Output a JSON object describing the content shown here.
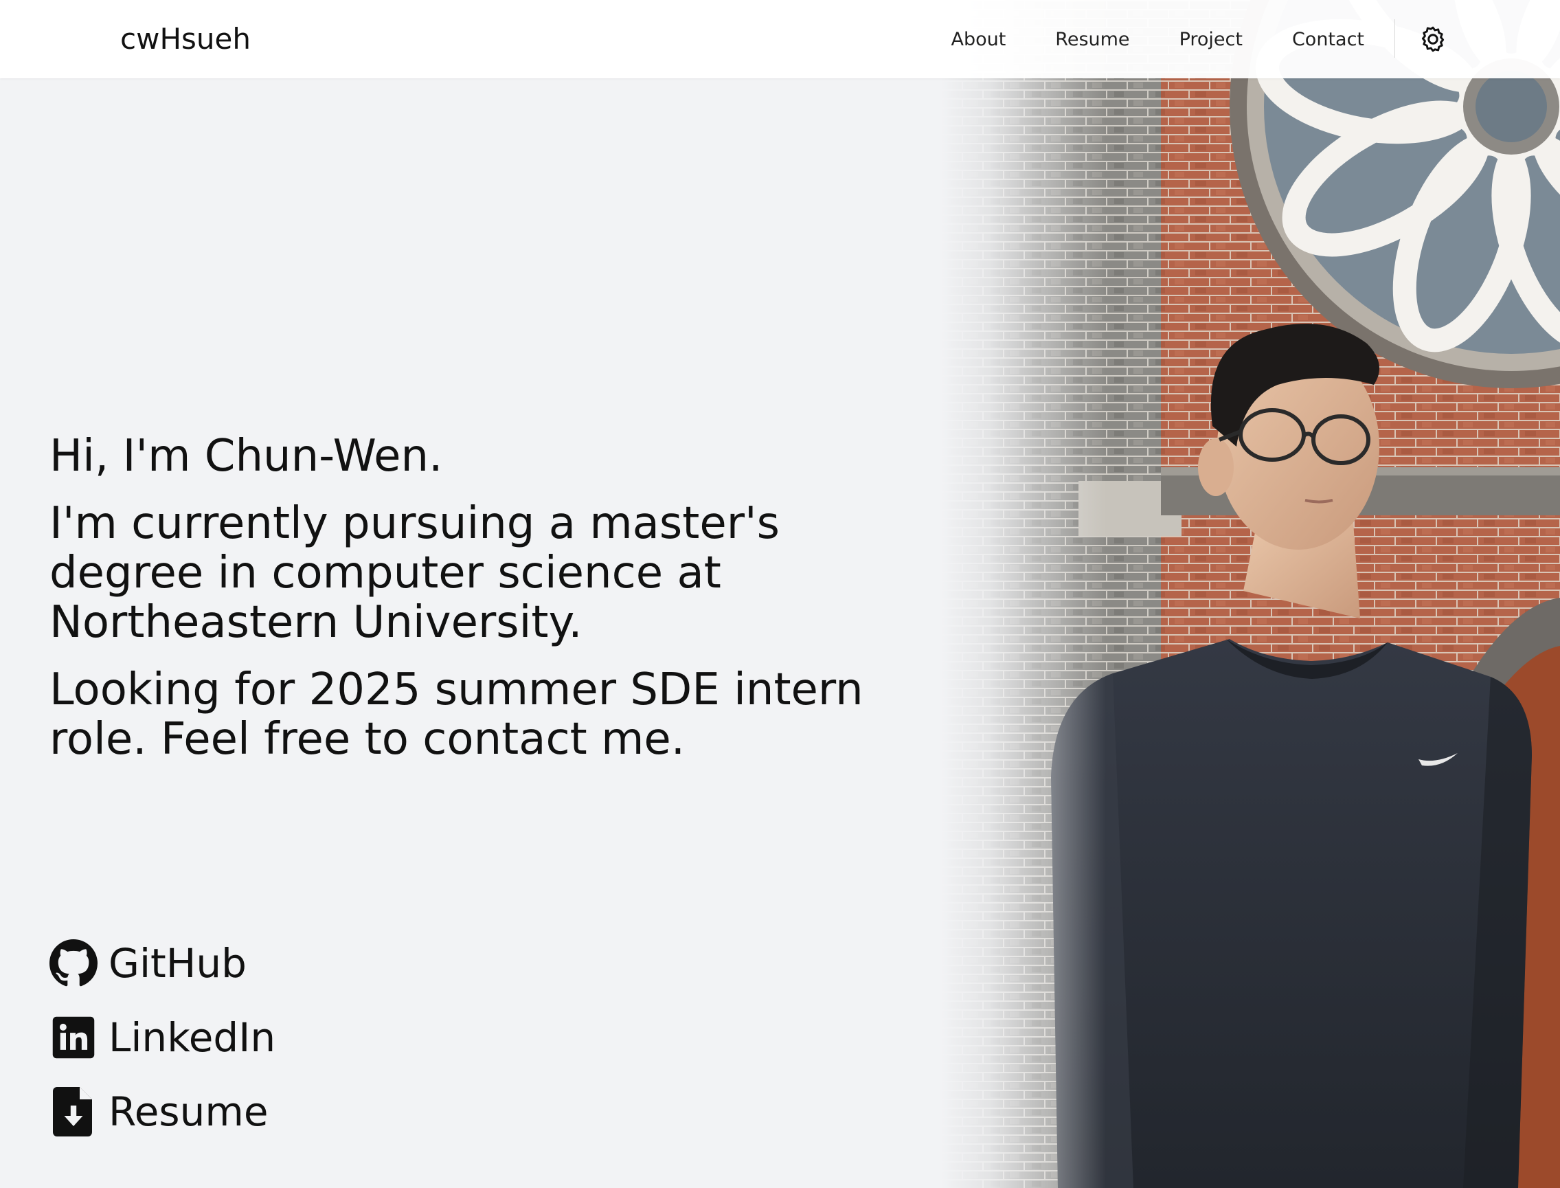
{
  "header": {
    "brand": "cwHsueh",
    "nav": [
      "About",
      "Resume",
      "Project",
      "Contact"
    ],
    "theme_toggle_icon": "gear-icon"
  },
  "hero": {
    "greeting": "Hi, I'm Chun-Wen.",
    "study": "I'm currently pursuing a master's degree in computer science at Northeastern University.",
    "seeking": "Looking for 2025 summer SDE intern role. Feel free to contact me."
  },
  "links": [
    {
      "label": "GitHub",
      "icon": "github-icon"
    },
    {
      "label": "LinkedIn",
      "icon": "linkedin-icon"
    },
    {
      "label": "Resume",
      "icon": "file-download-icon"
    }
  ],
  "colors": {
    "background": "#f2f3f5",
    "header": "#ffffff",
    "text": "#111111",
    "brick": "#a9583f",
    "sweater": "#2b2f37"
  }
}
